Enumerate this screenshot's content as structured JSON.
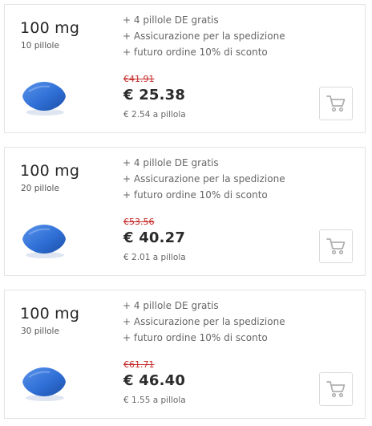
{
  "products": [
    {
      "dose": "100 mg",
      "quantity": "10 pillole",
      "benefits": [
        "+ 4 pillole DE gratis",
        "+ Assicurazione per la spedizione",
        "+ futuro ordine 10% di sconto"
      ],
      "old_price": "€41.91",
      "price": "€ 25.38",
      "unit_price": "€ 2.54 a pillola"
    },
    {
      "dose": "100 mg",
      "quantity": "20 pillole",
      "benefits": [
        "+ 4 pillole DE gratis",
        "+ Assicurazione per la spedizione",
        "+ futuro ordine 10% di sconto"
      ],
      "old_price": "€53.56",
      "price": "€ 40.27",
      "unit_price": "€ 2.01 a pillola"
    },
    {
      "dose": "100 mg",
      "quantity": "30 pillole",
      "benefits": [
        "+ 4 pillole DE gratis",
        "+ Assicurazione per la spedizione",
        "+ futuro ordine 10% di sconto"
      ],
      "old_price": "€61.71",
      "price": "€ 46.40",
      "unit_price": "€ 1.55 a pillola"
    }
  ],
  "icons": {
    "pill": "blue-pill-image",
    "cart": "shopping-cart-icon"
  },
  "colors": {
    "old_price": "#c62828",
    "pill_blue": "#2f6fd6",
    "border": "#e3e3e3",
    "cart_icon": "#b0b0b0"
  }
}
